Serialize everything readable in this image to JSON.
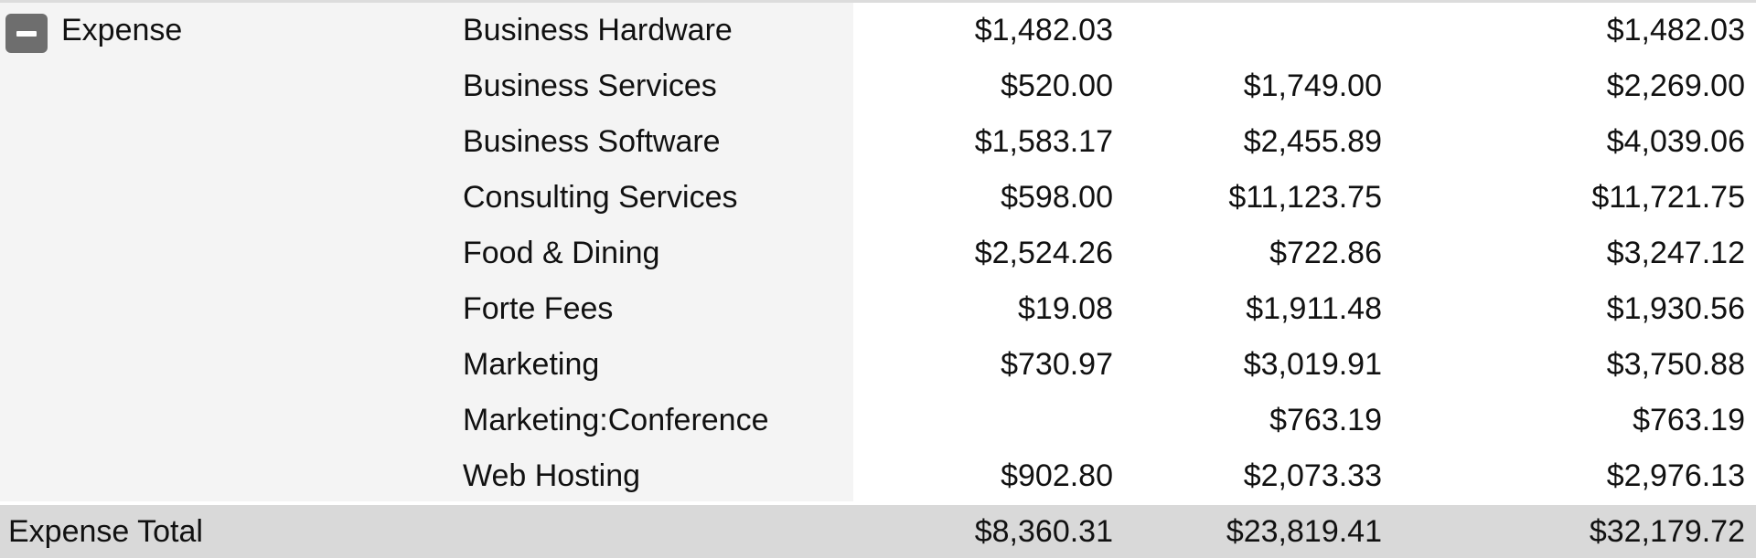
{
  "group": {
    "label": "Expense",
    "toggle_icon": "collapse-minus-icon",
    "expanded": true
  },
  "rows": [
    {
      "category": "Business Hardware",
      "col1": "$1,482.03",
      "col2": "",
      "total": "$1,482.03"
    },
    {
      "category": "Business Services",
      "col1": "$520.00",
      "col2": "$1,749.00",
      "total": "$2,269.00"
    },
    {
      "category": "Business Software",
      "col1": "$1,583.17",
      "col2": "$2,455.89",
      "total": "$4,039.06"
    },
    {
      "category": "Consulting Services",
      "col1": "$598.00",
      "col2": "$11,123.75",
      "total": "$11,721.75"
    },
    {
      "category": "Food & Dining",
      "col1": "$2,524.26",
      "col2": "$722.86",
      "total": "$3,247.12"
    },
    {
      "category": "Forte Fees",
      "col1": "$19.08",
      "col2": "$1,911.48",
      "total": "$1,930.56"
    },
    {
      "category": "Marketing",
      "col1": "$730.97",
      "col2": "$3,019.91",
      "total": "$3,750.88"
    },
    {
      "category": "Marketing:Conference",
      "col1": "",
      "col2": "$763.19",
      "total": "$763.19"
    },
    {
      "category": "Web Hosting",
      "col1": "$902.80",
      "col2": "$2,073.33",
      "total": "$2,976.13"
    }
  ],
  "total_row": {
    "label": "Expense Total",
    "col1": "$8,360.31",
    "col2": "$23,819.41",
    "total": "$32,179.72"
  },
  "colors": {
    "group_background": "#f4f4f4",
    "total_background": "#d9d9d9",
    "toggle_background": "#6e6e6e"
  }
}
